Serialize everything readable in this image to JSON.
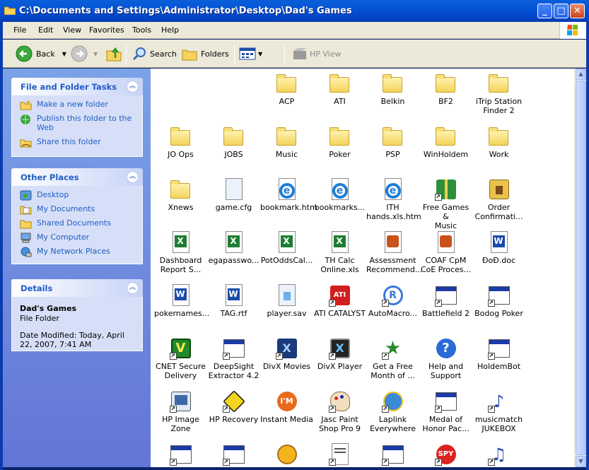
{
  "window": {
    "title": "C:\\Documents and Settings\\Administrator\\Desktop\\Dad's Games"
  },
  "menu": [
    "File",
    "Edit",
    "View",
    "Favorites",
    "Tools",
    "Help"
  ],
  "toolbar": {
    "back": "Back",
    "search": "Search",
    "folders": "Folders",
    "hpview": "HP View"
  },
  "tasks": {
    "title": "File and Folder Tasks",
    "items": [
      "Make a new folder",
      "Publish this folder to the Web",
      "Share this folder"
    ]
  },
  "places": {
    "title": "Other Places",
    "items": [
      "Desktop",
      "My Documents",
      "Shared Documents",
      "My Computer",
      "My Network Places"
    ]
  },
  "details": {
    "title": "Details",
    "name": "Dad's Games",
    "type": "File Folder",
    "modified": "Date Modified: Today, April 22, 2007, 7:41 AM"
  },
  "files": [
    {
      "label": "ACP",
      "icon": "folder-icon"
    },
    {
      "label": "ATI",
      "icon": "folder-icon"
    },
    {
      "label": "Belkin",
      "icon": "folder-icon"
    },
    {
      "label": "BF2",
      "icon": "folder-icon"
    },
    {
      "label": "iTrip Station\nFinder 2",
      "icon": "folder-icon"
    },
    {
      "label": "JO Ops",
      "icon": "folder-icon"
    },
    {
      "label": "JOBS",
      "icon": "folder-icon"
    },
    {
      "label": "Music",
      "icon": "folder-icon"
    },
    {
      "label": "Poker",
      "icon": "folder-icon"
    },
    {
      "label": "PSP",
      "icon": "folder-icon"
    },
    {
      "label": "WinHoldem",
      "icon": "folder-icon"
    },
    {
      "label": "Work",
      "icon": "folder-icon"
    },
    {
      "label": "Xnews",
      "icon": "folder-icon"
    },
    {
      "label": "game.cfg",
      "icon": "config-file-icon"
    },
    {
      "label": "bookmark.htm",
      "icon": "ie-document-icon"
    },
    {
      "label": "bookmarks...",
      "icon": "ie-document-icon"
    },
    {
      "label": "ITH\nhands.xls.htm",
      "icon": "ie-document-icon"
    },
    {
      "label": "Free Games &\nMusic",
      "icon": "gift-icon"
    },
    {
      "label": "Order\nConfirmati...",
      "icon": "archive-icon"
    },
    {
      "label": "Dashboard\nReport S...",
      "icon": "excel-icon"
    },
    {
      "label": "egapasswo...",
      "icon": "excel-icon"
    },
    {
      "label": "PotOddsCal...",
      "icon": "excel-icon"
    },
    {
      "label": "TH Calc\nOnline.xls",
      "icon": "excel-icon"
    },
    {
      "label": "Assessment\nRecommend...",
      "icon": "powerpoint-icon"
    },
    {
      "label": "COAF CpM\nCoE Proces...",
      "icon": "powerpoint-icon"
    },
    {
      "label": "ÐoÐ.doc",
      "icon": "word-icon"
    },
    {
      "label": "pokernames...",
      "icon": "word-icon"
    },
    {
      "label": "TAG.rtf",
      "icon": "word-icon"
    },
    {
      "label": "player.sav",
      "icon": "file-icon"
    },
    {
      "label": "ATI CATALYST",
      "icon": "ati-icon"
    },
    {
      "label": "AutoMacro...",
      "icon": "automacro-icon"
    },
    {
      "label": "Battlefield 2",
      "icon": "app-window-icon"
    },
    {
      "label": "Bodog Poker",
      "icon": "app-window-icon"
    },
    {
      "label": "CNET Secure\nDelivery",
      "icon": "cnet-icon"
    },
    {
      "label": "DeepSight\nExtractor 4.2",
      "icon": "app-window-icon"
    },
    {
      "label": "DivX Movies",
      "icon": "divx-icon"
    },
    {
      "label": "DivX Player",
      "icon": "divx-player-icon"
    },
    {
      "label": "Get a Free\nMonth of ...",
      "icon": "runner-icon"
    },
    {
      "label": "Help and\nSupport",
      "icon": "help-icon"
    },
    {
      "label": "HoldemBot",
      "icon": "app-window-icon"
    },
    {
      "label": "HP Image\nZone",
      "icon": "hp-image-icon"
    },
    {
      "label": "HP Recovery",
      "icon": "hp-recovery-icon"
    },
    {
      "label": "Instant Media",
      "icon": "instant-media-icon"
    },
    {
      "label": "Jasc Paint\nShop Pro 9",
      "icon": "paint-icon"
    },
    {
      "label": "Laplink\nEverywhere",
      "icon": "laplink-icon"
    },
    {
      "label": "Medal of\nHonor Pac...",
      "icon": "app-window-icon"
    },
    {
      "label": "musicmatch\nJUKEBOX",
      "icon": "musicmatch-icon"
    },
    {
      "label": "",
      "icon": "app-window-icon"
    },
    {
      "label": "",
      "icon": "app-window-icon"
    },
    {
      "label": "",
      "icon": "globe-icon"
    },
    {
      "label": "",
      "icon": "document-icon"
    },
    {
      "label": "",
      "icon": "app-window-icon"
    },
    {
      "label": "",
      "icon": "spy-icon"
    },
    {
      "label": "",
      "icon": "music-icon"
    }
  ]
}
